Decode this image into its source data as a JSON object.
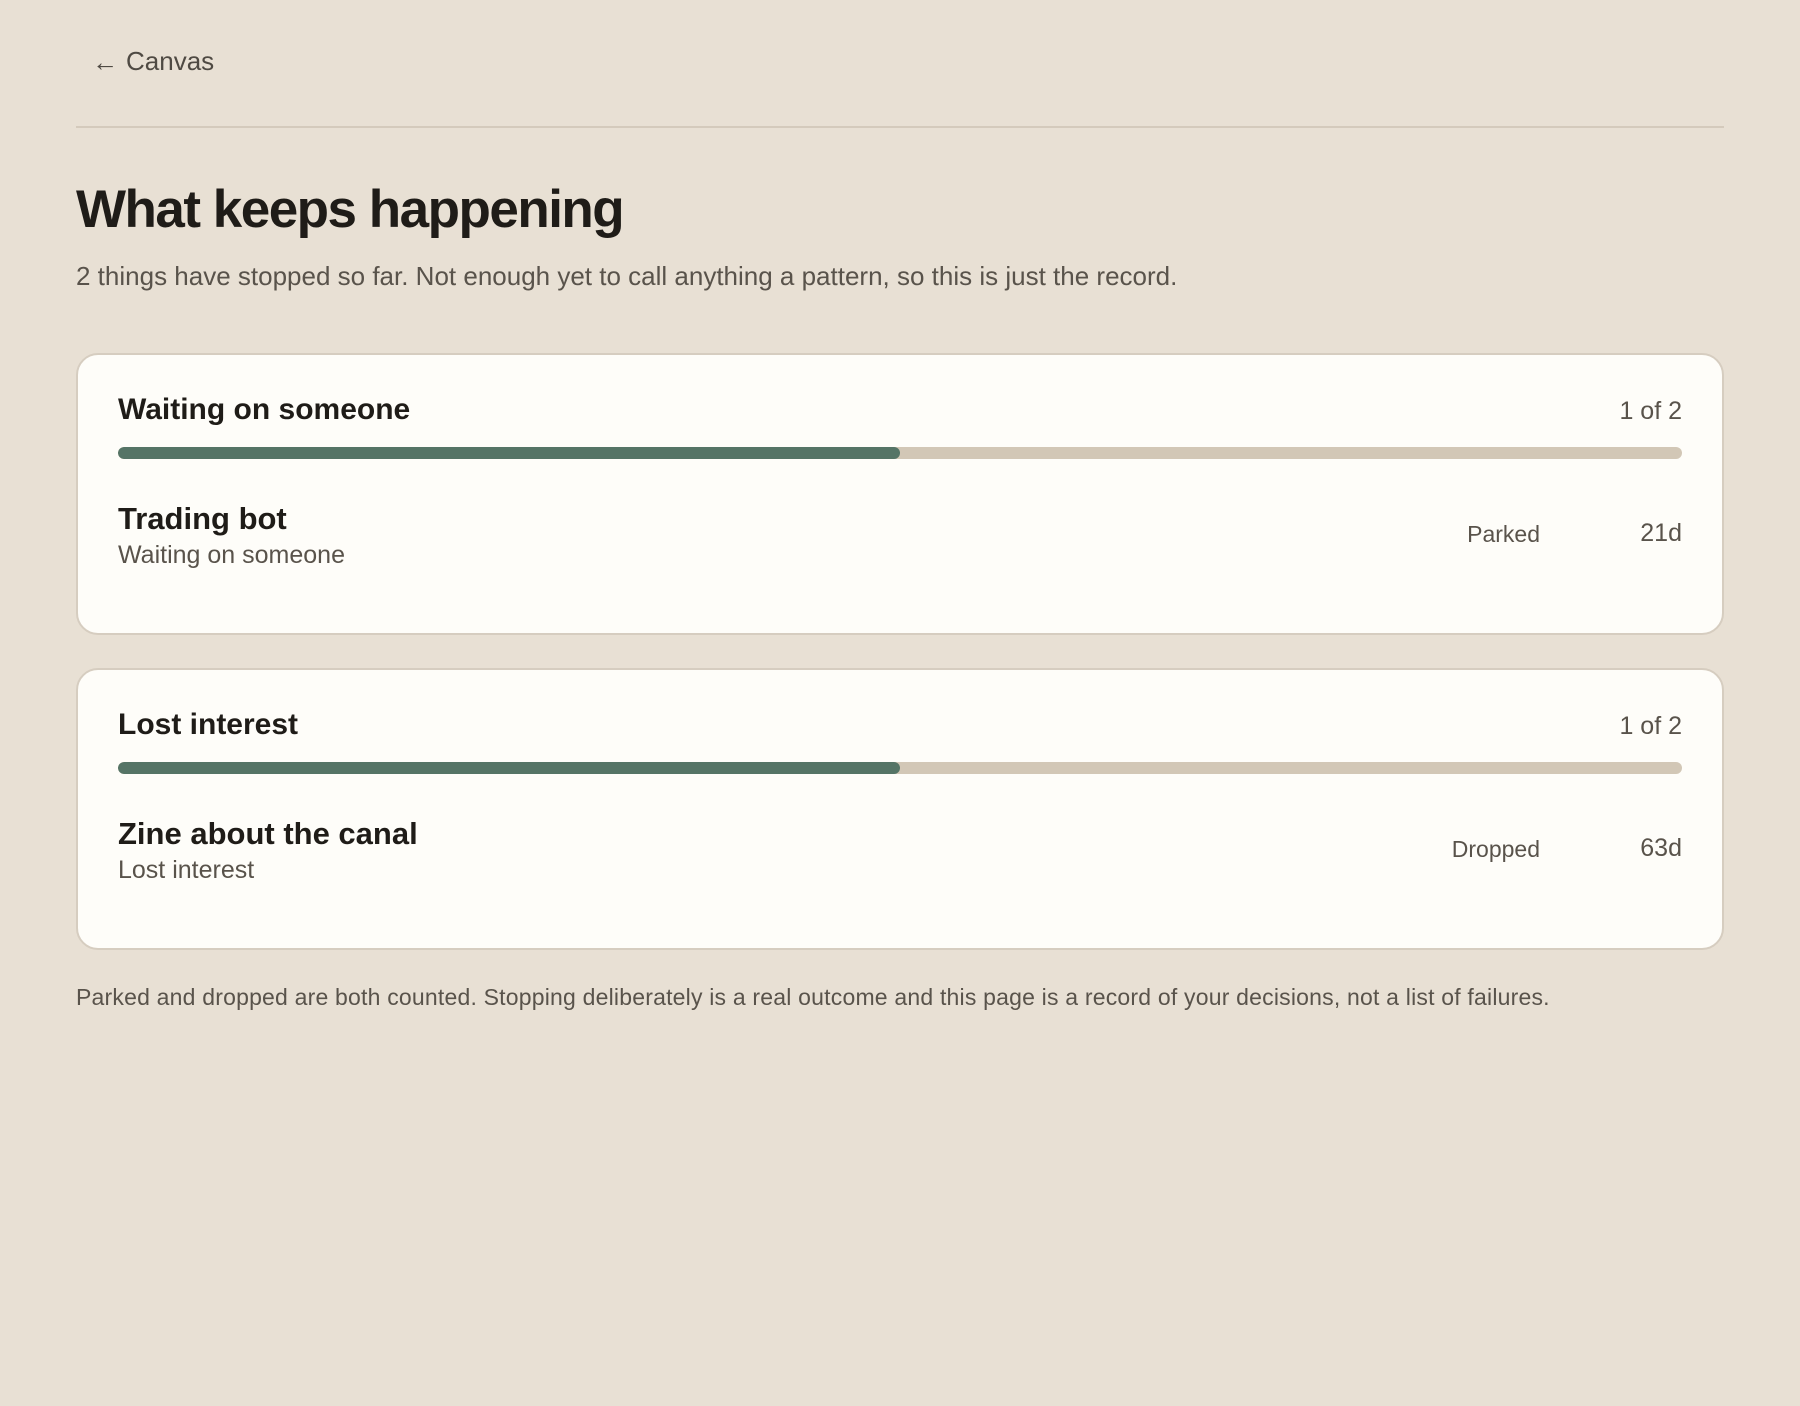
{
  "nav": {
    "back_label": "Canvas"
  },
  "header": {
    "title": "What keeps happening",
    "subtitle": "2 things have stopped so far. Not enough yet to call anything a pattern, so this is just the record."
  },
  "groups": [
    {
      "title": "Waiting on someone",
      "count": "1 of 2",
      "progress": 0.5,
      "items": [
        {
          "name": "Trading bot",
          "reason": "Waiting on someone",
          "status": "Parked",
          "age": "21d"
        }
      ]
    },
    {
      "title": "Lost interest",
      "count": "1 of 2",
      "progress": 0.5,
      "items": [
        {
          "name": "Zine about the canal",
          "reason": "Lost interest",
          "status": "Dropped",
          "age": "63d"
        }
      ]
    }
  ],
  "footer": {
    "note": "Parked and dropped are both counted. Stopping deliberately is a real outcome and this page is a record of your decisions, not a list of failures."
  },
  "colors": {
    "background": "#e8e0d4",
    "card": "#fefdf9",
    "bar_fill": "#557466",
    "bar_track": "#d2c7b6"
  }
}
